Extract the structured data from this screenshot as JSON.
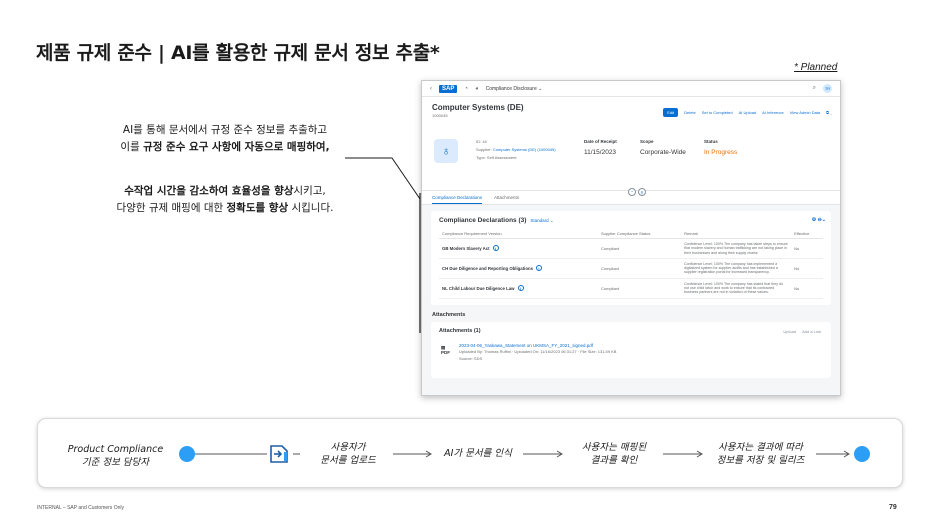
{
  "slide": {
    "title": "제품 규제 준수 | AI를 활용한 규제 문서 정보 추출*",
    "planned": "* Planned",
    "desc1": {
      "line1": "AI를 통해 문서에서 규정 준수 정보를 추출하고",
      "line2_pre": "이를 ",
      "line2_bold": "규정 준수 요구 사항에 자동으로 매핑하여,"
    },
    "desc2": {
      "line1_bold1": "수작업 시간을 감소하여 효율성을 향상",
      "line1_post": "시키고,",
      "line2_pre": "다양한 규제 매핑에 대한 ",
      "line2_bold": "정확도를 향상",
      "line2_post": " 시킵니다."
    },
    "footer": "INTERNAL – SAP and Customers Only",
    "page_number": "79"
  },
  "app": {
    "shell": {
      "logo": "SAP",
      "title": "Compliance Disclosure ⌄",
      "avatar": "TR"
    },
    "header": {
      "title": "Computer Systems (DE)",
      "subtitle": "1000045",
      "actions": [
        "Edit",
        "Delete",
        "Set to Completed",
        "AI Upload",
        "AI Inference",
        "View Admin Data"
      ],
      "id_label": "ID:",
      "id_value": "16",
      "supplier_label": "Supplier:",
      "supplier_value": "Computer Systems (DE) (1000045)",
      "type_label": "Type:",
      "type_value": "Self Assessment",
      "receipt_label": "Date of Receipt",
      "receipt_value": "11/15/2023",
      "scope_label": "Scope",
      "scope_value": "Corporate-Wide",
      "status_label": "Status",
      "status_value": "In Progress"
    },
    "tabs": [
      "Compliance Declarations",
      "Attachments"
    ],
    "declarations": {
      "title": "Compliance Declarations (3)",
      "variant": "Standard ⌄",
      "columns": [
        "Compliance Requirement Version",
        "Supplier Compliance Status",
        "Remark",
        "Effective"
      ],
      "rows": [
        {
          "req": "GB Modern Slavery Act",
          "status": "Compliant",
          "remark": "Confidence Level: 100% The company has taken steps to ensure that modern slavery and human trafficking are not taking place in their businesses and along their supply chains",
          "eff": "No"
        },
        {
          "req": "CH Due Diligence and Reporting Obligations",
          "status": "Compliant",
          "remark": "Confidence Level: 100% The company has implemented a digitalized system for supplier audits and has established a supplier registration portal for increased transparency.",
          "eff": "No"
        },
        {
          "req": "NL Child Labour Due Diligence Law",
          "status": "Compliant",
          "remark": "Confidence Level: 100% The company has stated that they do not use child labor and work to ensure that its contracted business partners are not in violation of these values.",
          "eff": "No"
        }
      ]
    },
    "attachments": {
      "section_label": "Attachments",
      "title": "Attachments (1)",
      "tools": [
        "Upload",
        "Add a Link"
      ],
      "pdf_label": "PDF",
      "file_name": "2023-04-06_Yaskawa_Statement on UKMSA_FY_2021_signed.pdf",
      "uploaded": "Uploaded By: Thomas Ruffini · Uploaded On: 11/16/2023 06:31:27 · File Size: 131.59 KB",
      "source": "Source: SDS"
    }
  },
  "flow": {
    "role_line1": "Product Compliance",
    "role_line2": "기준 정보 담당자",
    "step1_line1": "사용자가",
    "step1_line2": "문서를 업로드",
    "step2": "AI가 문서를 인식",
    "step3_line1": "사용자는 매핑된",
    "step3_line2": "결과를 확인",
    "step4_line1": "사용자는 결과에 따라",
    "step4_line2": "정보를 저장 및 릴리즈",
    "accent": "#2d9ef5"
  }
}
